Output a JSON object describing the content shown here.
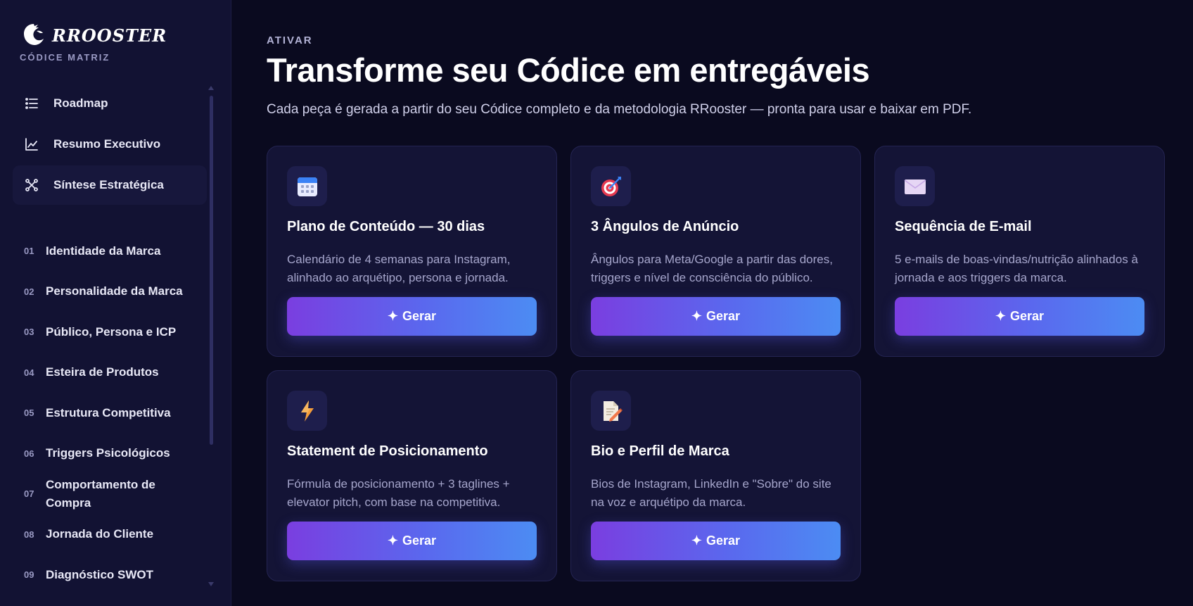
{
  "sidebar": {
    "brand": {
      "name": "RROOSTER",
      "subtitle": "CÓDICE MATRIZ"
    },
    "nav": [
      {
        "label": "Roadmap",
        "icon": "list-icon"
      },
      {
        "label": "Resumo Executivo",
        "icon": "chart-line-icon"
      },
      {
        "label": "Síntese Estratégica",
        "icon": "network-icon",
        "active": true
      }
    ],
    "sections": [
      {
        "num": "01",
        "label": "Identidade da Marca"
      },
      {
        "num": "02",
        "label": "Personalidade da Marca"
      },
      {
        "num": "03",
        "label": "Público, Persona e ICP"
      },
      {
        "num": "04",
        "label": "Esteira de Produtos"
      },
      {
        "num": "05",
        "label": "Estrutura Competitiva"
      },
      {
        "num": "06",
        "label": "Triggers Psicológicos"
      },
      {
        "num": "07",
        "label": "Comportamento de Compra"
      },
      {
        "num": "08",
        "label": "Jornada do Cliente"
      },
      {
        "num": "09",
        "label": "Diagnóstico SWOT"
      }
    ]
  },
  "main": {
    "eyebrow": "ATIVAR",
    "title": "Transforme seu Códice em entregáveis",
    "subtitle": "Cada peça é gerada a partir do seu Códice completo e da metodologia RRooster — pronta para usar e baixar em PDF.",
    "cards": [
      {
        "icon": "calendar-icon",
        "title": "Plano de Conteúdo — 30 dias",
        "desc": "Calendário de 4 semanas para Instagram, alinhado ao arquétipo, persona e jornada.",
        "button": "Gerar"
      },
      {
        "icon": "target-icon",
        "title": "3 Ângulos de Anúncio",
        "desc": "Ângulos para Meta/Google a partir das dores, triggers e nível de consciência do público.",
        "button": "Gerar"
      },
      {
        "icon": "envelope-icon",
        "title": "Sequência de E-mail",
        "desc": "5 e-mails de boas-vindas/nutrição alinhados à jornada e aos triggers da marca.",
        "button": "Gerar"
      },
      {
        "icon": "lightning-icon",
        "title": "Statement de Posicionamento",
        "desc": "Fórmula de posicionamento + 3 taglines + elevator pitch, com base na competitiva.",
        "button": "Gerar"
      },
      {
        "icon": "document-pen-icon",
        "title": "Bio e Perfil de Marca",
        "desc": "Bios de Instagram, LinkedIn e \"Sobre\" do site na voz e arquétipo da marca.",
        "button": "Gerar"
      }
    ]
  },
  "colors": {
    "background": "#0a0a1f",
    "sidebar": "#121233",
    "card": "#141436",
    "button_start": "#7a3ee0",
    "button_end": "#4c8cf3"
  }
}
